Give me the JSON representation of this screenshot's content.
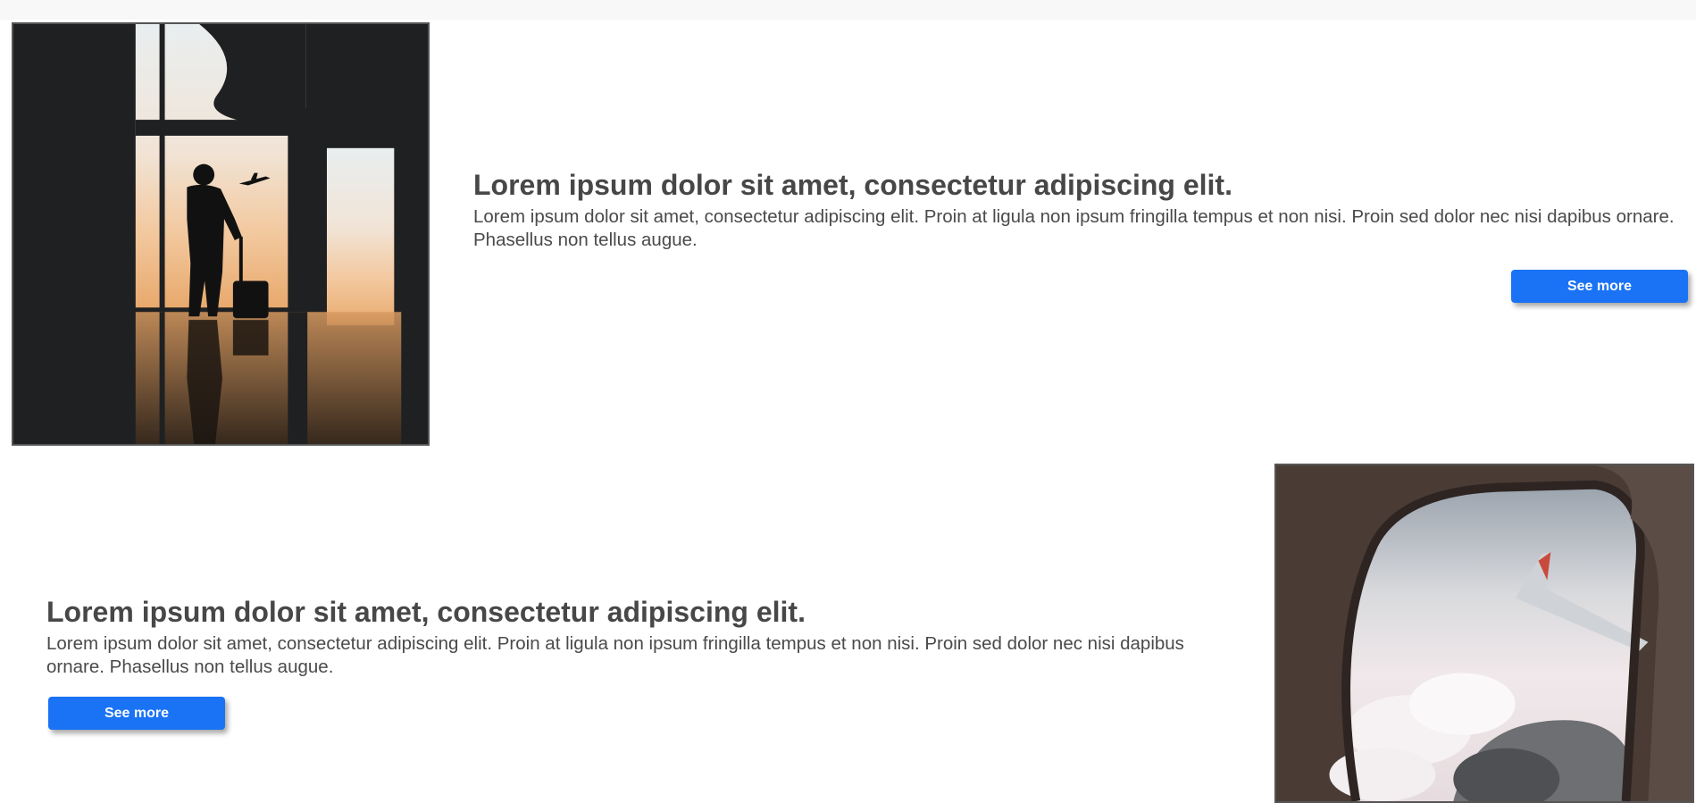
{
  "sections": [
    {
      "heading": "Lorem ipsum dolor sit amet, consectetur adipiscing elit.",
      "body": "Lorem ipsum dolor sit amet, consectetur adipiscing elit. Proin at ligula non ipsum fringilla tempus et non nisi. Proin sed dolor nec nisi dapibus ornare. Phasellus non tellus augue.",
      "button_label": "See more",
      "image_icon": "traveler-silhouette-photo"
    },
    {
      "heading": "Lorem ipsum dolor sit amet, consectetur adipiscing elit.",
      "body": "Lorem ipsum dolor sit amet, consectetur adipiscing elit. Proin at ligula non ipsum fringilla tempus et non nisi. Proin sed dolor nec nisi dapibus ornare. Phasellus non tellus augue.",
      "button_label": "See more",
      "image_icon": "airplane-window-photo"
    }
  ],
  "colors": {
    "button": "#1a73f5",
    "button_text": "#ffffff",
    "heading": "#474747",
    "body_text": "#4a4a4a",
    "image_border": "#555555"
  }
}
